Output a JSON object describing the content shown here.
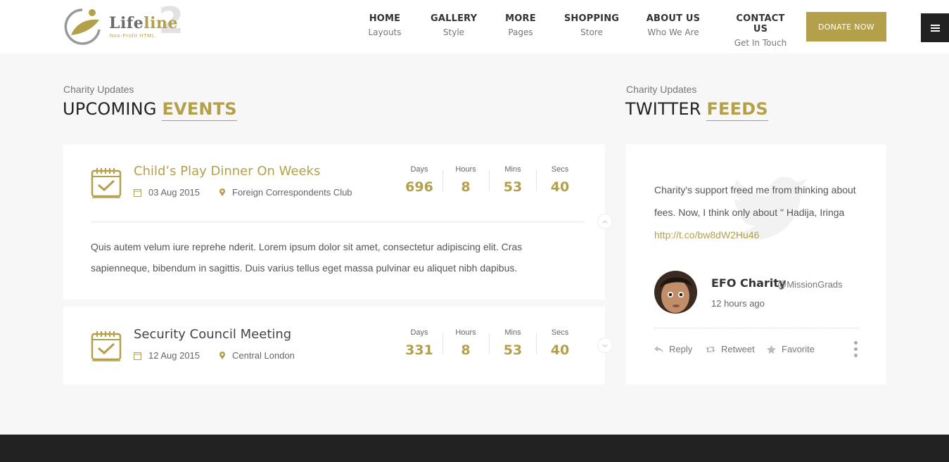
{
  "header": {
    "logo": {
      "brand_a": "Life",
      "brand_b": "line",
      "number": "2",
      "tagline": "Non-Profit HTML"
    },
    "nav": [
      {
        "title": "HOME",
        "sub": "Layouts"
      },
      {
        "title": "GALLERY",
        "sub": "Style"
      },
      {
        "title": "MORE",
        "sub": "Pages"
      },
      {
        "title": "SHOPPING",
        "sub": "Store"
      },
      {
        "title": "ABOUT US",
        "sub": "Who We Are"
      },
      {
        "title": "CONTACT US",
        "sub": "Get In Touch"
      }
    ],
    "donate_label": "DONATE NOW"
  },
  "events_section": {
    "pre": "Charity Updates",
    "title_a": "UPCOMING ",
    "title_b": "EVENTS"
  },
  "twitter_section": {
    "pre": "Charity Updates",
    "title_a": "TWITTER ",
    "title_b": "FEEDS"
  },
  "countdown_labels": {
    "days": "Days",
    "hours": "Hours",
    "mins": "Mins",
    "secs": "Secs"
  },
  "events": [
    {
      "title": "Child’s Play Dinner On Weeks",
      "date": "03 Aug 2015",
      "location": "Foreign Correspondents Club",
      "days": "696",
      "hours": "8",
      "mins": "53",
      "secs": "40",
      "description": "Quis autem velum iure reprehe nderit. Lorem ipsum dolor sit amet, consectetur adipiscing elit. Cras sapienneque, bibendum in sagittis. Duis varius tellus eget massa pulvinar eu aliquet nibh dapibus."
    },
    {
      "title": "Security Council Meeting",
      "date": "12 Aug 2015",
      "location": "Central London",
      "days": "331",
      "hours": "8",
      "mins": "53",
      "secs": "40"
    }
  ],
  "tweet": {
    "text": "Charity's support freed me from thinking about fees. Now, I think only about \" Hadija, Iringa ",
    "link": "http://t.co/bw8dW2Hu46",
    "name": "EFO Charity",
    "handle": "@MissionGrads",
    "time": "12 hours ago",
    "actions": {
      "reply": "Reply",
      "retweet": "Retweet",
      "favorite": "Favorite"
    }
  },
  "colors": {
    "accent": "#b4a04b",
    "dark": "#222222",
    "background": "#f7f7f7"
  }
}
